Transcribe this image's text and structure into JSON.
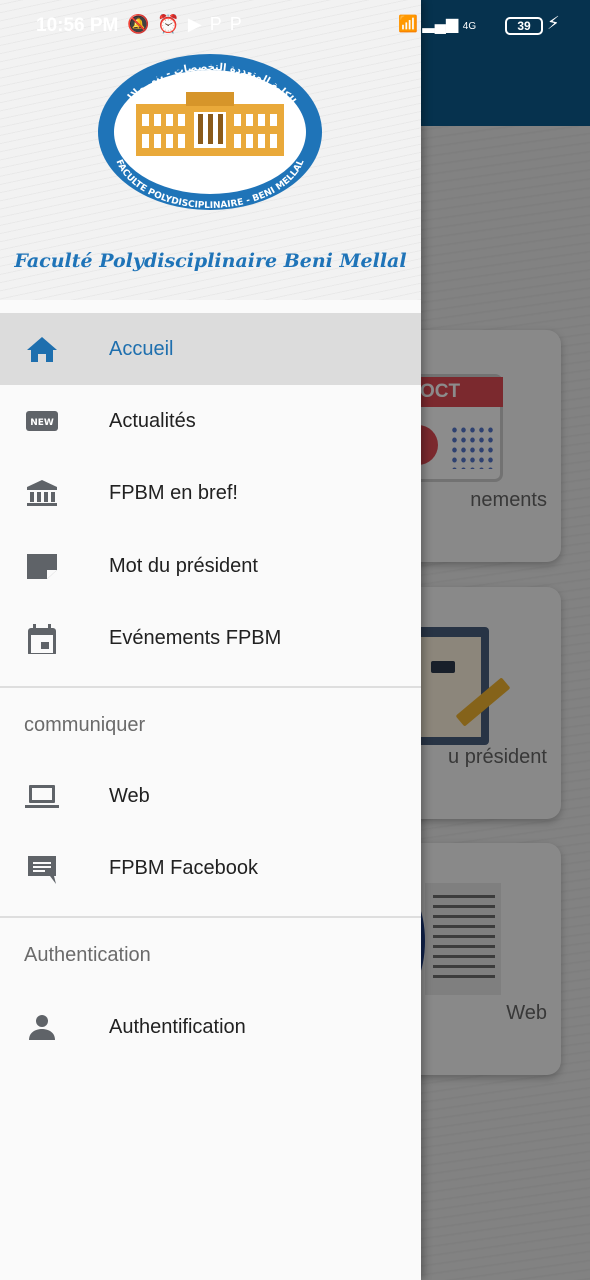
{
  "status_bar": {
    "time": "10:56 PM",
    "battery": "39",
    "network": "4G"
  },
  "background": {
    "cards": [
      {
        "label": "nements"
      },
      {
        "label": "u président"
      },
      {
        "label": "Web"
      }
    ],
    "calendar_month": "OCT"
  },
  "drawer": {
    "logo_text_arabic": "الكلية المتعددة التخصصات - بني ملال",
    "logo_text_french": "FACULTE POLYDISCIPLINAIRE - BENI MELLAL",
    "header_title": "Faculté Polydisciplinaire Beni Mellal",
    "items": [
      {
        "label": "Accueil",
        "icon": "home-icon",
        "active": true
      },
      {
        "label": "Actualités",
        "icon": "new-badge-icon"
      },
      {
        "label": "FPBM en bref!",
        "icon": "bank-icon"
      },
      {
        "label": "Mot du président",
        "icon": "note-icon"
      },
      {
        "label": "Evénements FPBM",
        "icon": "calendar-icon"
      }
    ],
    "section_communiquer": "communiquer",
    "communiquer_items": [
      {
        "label": "Web",
        "icon": "laptop-icon"
      },
      {
        "label": "FPBM Facebook",
        "icon": "chat-icon"
      }
    ],
    "section_auth": "Authentication",
    "auth_items": [
      {
        "label": "Authentification",
        "icon": "person-icon"
      }
    ]
  },
  "colors": {
    "accent": "#1e6fae",
    "icon": "#5f6368",
    "toolbar": "#0b5c8f"
  }
}
